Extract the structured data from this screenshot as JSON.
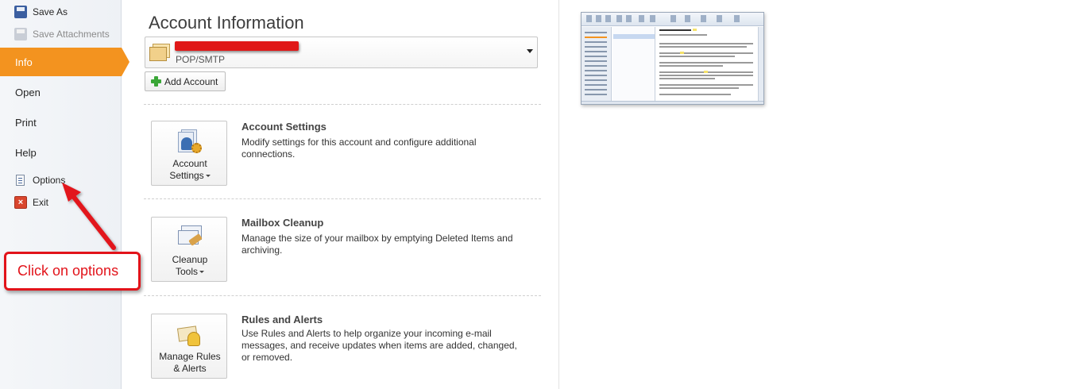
{
  "nav": {
    "save_as": "Save As",
    "save_attachments": "Save Attachments",
    "info": "Info",
    "open": "Open",
    "print": "Print",
    "help": "Help",
    "options": "Options",
    "exit": "Exit"
  },
  "main": {
    "title": "Account Information",
    "account": {
      "type": "POP/SMTP"
    },
    "add_account_label": "Add Account",
    "sections": [
      {
        "button_line1": "Account",
        "button_line2": "Settings",
        "title": "Account Settings",
        "description": "Modify settings for this account and configure additional connections."
      },
      {
        "button_line1": "Cleanup",
        "button_line2": "Tools",
        "title": "Mailbox Cleanup",
        "description": "Manage the size of your mailbox by emptying Deleted Items and archiving."
      },
      {
        "button_line1": "Manage Rules",
        "button_line2": "& Alerts",
        "title": "Rules and Alerts",
        "description": "Use Rules and Alerts to help organize your incoming e-mail messages, and receive updates when items are added, changed, or removed."
      }
    ]
  },
  "annotation": {
    "text": "Click on options",
    "color": "#e2131a"
  },
  "colors": {
    "active_tab": "#f3931f",
    "nav_background": "#eef1f5"
  }
}
